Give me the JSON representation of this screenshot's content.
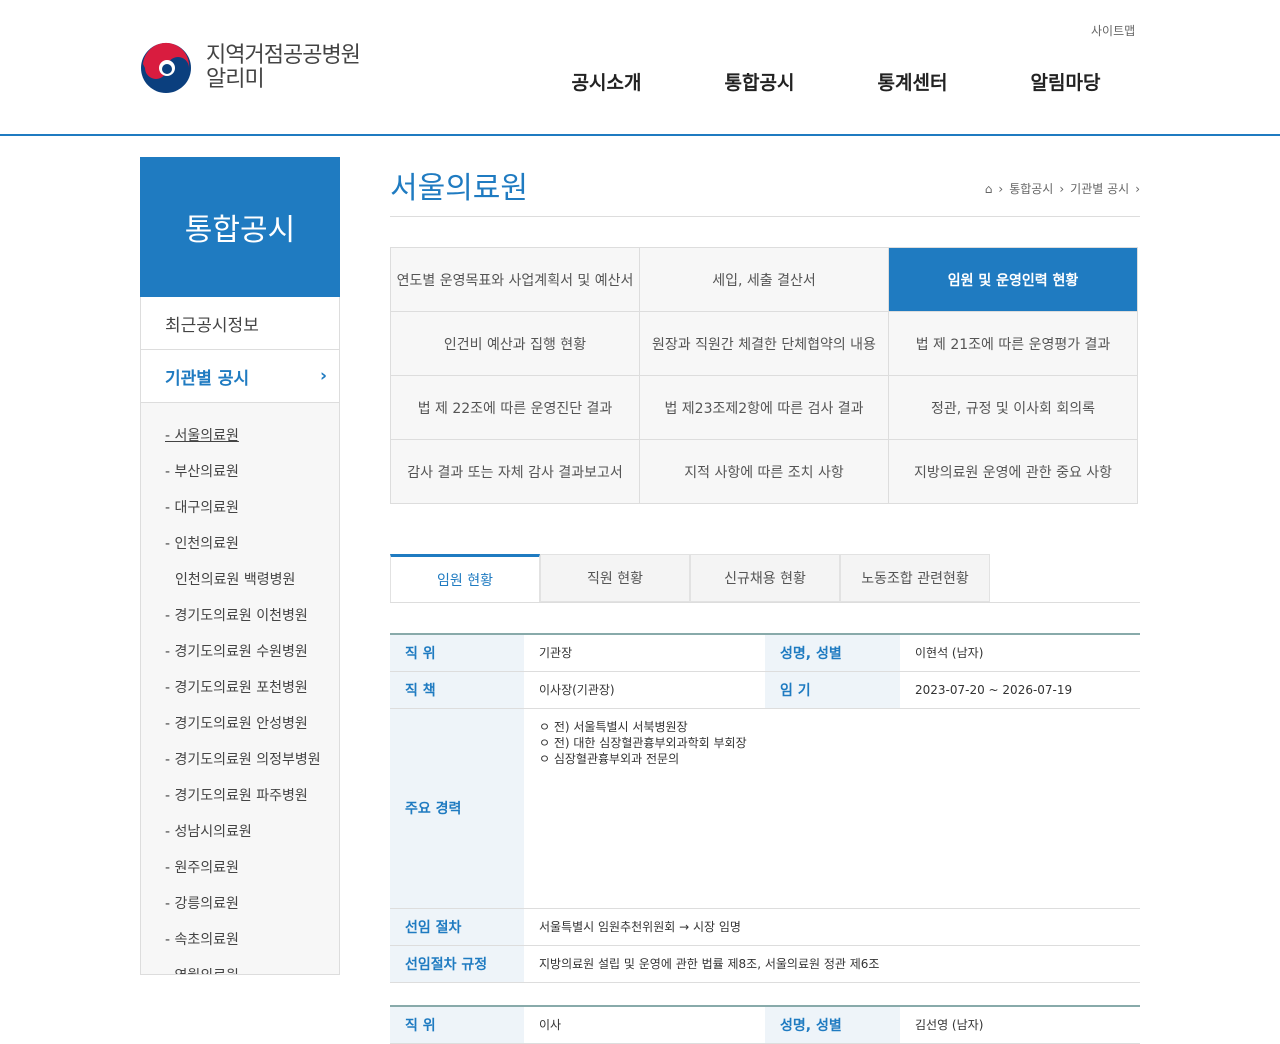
{
  "header": {
    "sitemap": "사이트맵",
    "logo_line1": "지역거점공공병원",
    "logo_line2": "알리미",
    "nav": [
      "공시소개",
      "통합공시",
      "통계센터",
      "알림마당"
    ]
  },
  "sidebar": {
    "title": "통합공시",
    "items": [
      "최근공시정보",
      "기관별 공시"
    ],
    "sub": [
      "- 서울의료원",
      "- 부산의료원",
      "- 대구의료원",
      "- 인천의료원",
      "인천의료원 백령병원",
      "- 경기도의료원 이천병원",
      "- 경기도의료원 수원병원",
      "- 경기도의료원 포천병원",
      "- 경기도의료원 안성병원",
      "- 경기도의료원 의정부병원",
      "- 경기도의료원 파주병원",
      "- 성남시의료원",
      "- 원주의료원",
      "- 강릉의료원",
      "- 속초의료원",
      "- 영월의료원"
    ]
  },
  "page": {
    "title": "서울의료원",
    "breadcrumb": [
      "통합공시",
      "기관별 공시"
    ]
  },
  "categories": [
    "연도별 운영목표와 사업계획서 및 예산서",
    "세입, 세출 결산서",
    "임원 및 운영인력 현황",
    "인건비 예산과 집행 현황",
    "원장과 직원간 체결한 단체협약의 내용",
    "법 제 21조에 따른 운영평가 결과",
    "법 제 22조에 따른 운영진단 결과",
    "법 제23조제2항에 따른 검사 결과",
    "정관, 규정 및 이사회 회의록",
    "감사 결과 또는 자체 감사 결과보고서",
    "지적 사항에 따른 조치 사항",
    "지방의료원 운영에 관한 중요 사항"
  ],
  "tabs": [
    "임원 현황",
    "직원 현황",
    "신규채용 현황",
    "노동조합 관련현황"
  ],
  "labels": {
    "position": "직 위",
    "name": "성명, 성별",
    "duty": "직 책",
    "term": "임 기",
    "career": "주요 경력",
    "proc": "선임 절차",
    "rule": "선임절차 규정"
  },
  "officers": [
    {
      "position": "기관장",
      "name": "이현석 (남자)",
      "duty": "이사장(기관장)",
      "term": "2023-07-20 ~ 2026-07-19",
      "career": [
        "ㅇ 전) 서울특별시 서북병원장",
        "ㅇ 전) 대한 심장혈관흉부외과학회 부회장",
        "ㅇ 심장혈관흉부외과 전문의"
      ],
      "proc": "서울특별시 임원추천위원회 → 시장 임명",
      "rule": "지방의료원 설립 및 운영에 관한 법률 제8조, 서울의료원 정관 제6조"
    },
    {
      "position": "이사",
      "name": "김선영 (남자)"
    }
  ]
}
